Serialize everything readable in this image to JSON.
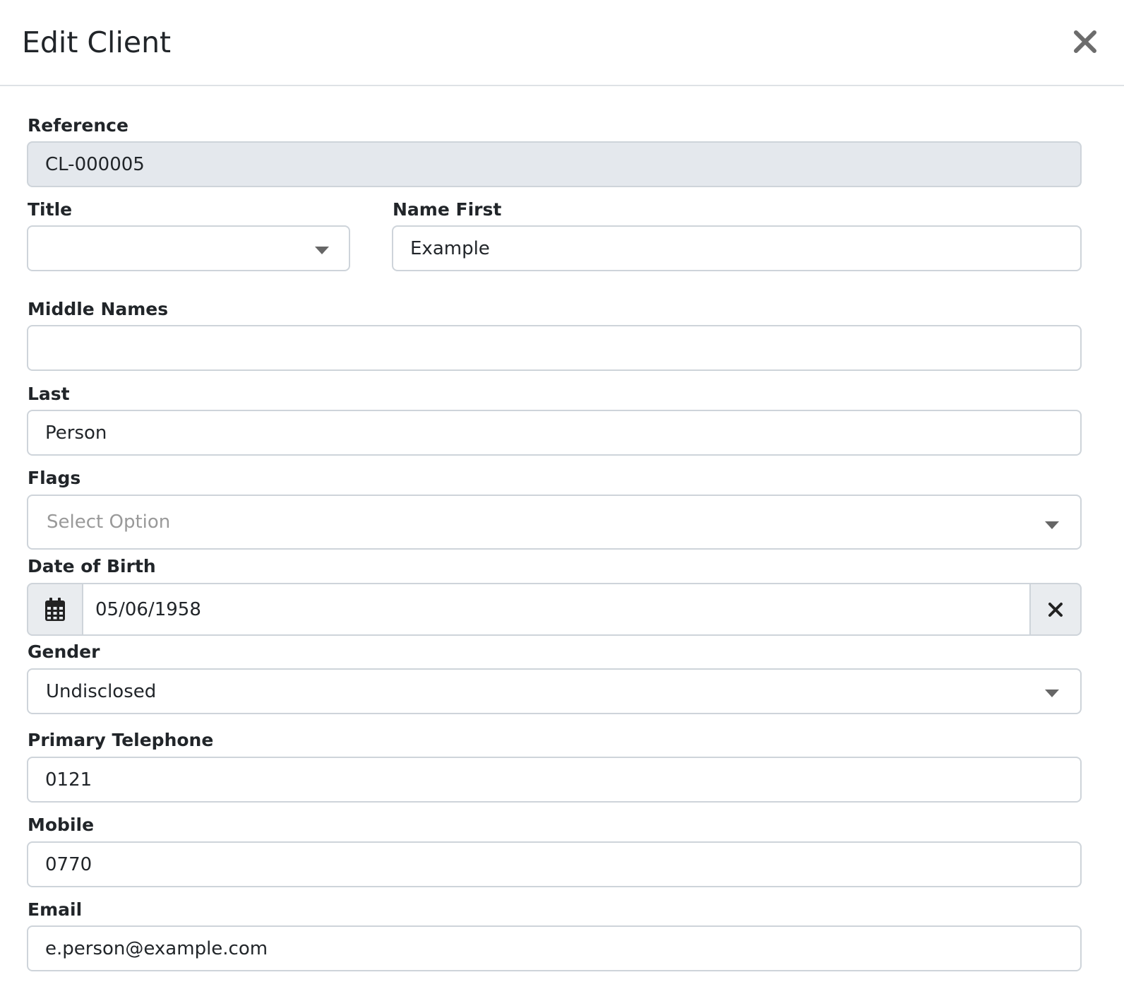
{
  "modal": {
    "title": "Edit Client",
    "close_icon": "close-icon"
  },
  "form": {
    "reference": {
      "label": "Reference",
      "value": "CL-000005"
    },
    "title": {
      "label": "Title",
      "value": ""
    },
    "name_first": {
      "label": "Name First",
      "value": "Example"
    },
    "middle_names": {
      "label": "Middle Names",
      "value": ""
    },
    "last": {
      "label": "Last",
      "value": "Person"
    },
    "flags": {
      "label": "Flags",
      "placeholder": "Select Option"
    },
    "dob": {
      "label": "Date of Birth",
      "value": "05/06/1958",
      "calendar_icon": "calendar-icon",
      "clear_icon": "clear-icon"
    },
    "gender": {
      "label": "Gender",
      "value": "Undisclosed"
    },
    "primary_telephone": {
      "label": "Primary Telephone",
      "value": "0121"
    },
    "mobile": {
      "label": "Mobile",
      "value": "0770"
    },
    "email": {
      "label": "Email",
      "value": "e.person@example.com"
    }
  },
  "colors": {
    "readonly_bg": "#e4e8ed",
    "border": "#ced4da",
    "text": "#212529",
    "placeholder": "#999999"
  }
}
